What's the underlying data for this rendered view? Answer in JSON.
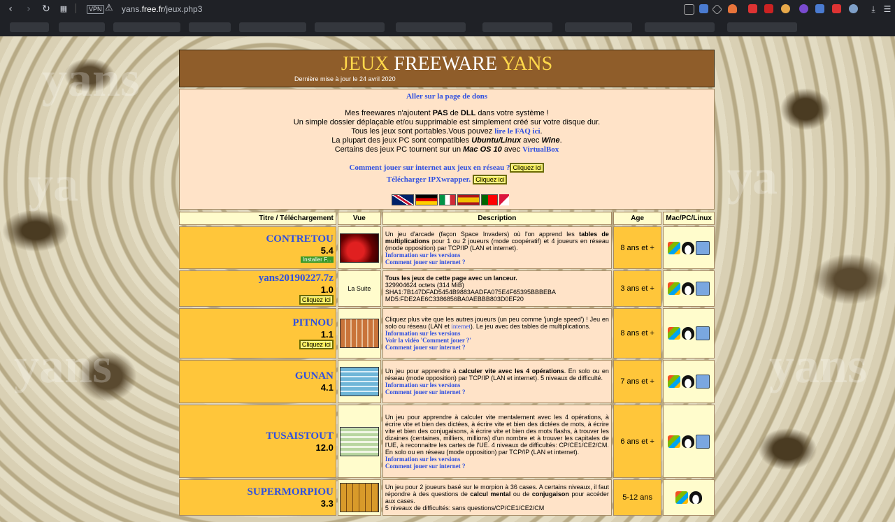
{
  "browser": {
    "url_prefix": "yans.",
    "url_domain": "free.fr",
    "url_path": "/jeux.php3",
    "vpn_label": "VPN"
  },
  "header": {
    "title_a": "JEUX",
    "title_b": "FREEWARE",
    "title_c": "YANS",
    "updated": "Dernière mise à jour le 24 avril 2020"
  },
  "intro": {
    "donate_link": "Aller sur la page de dons",
    "line1_pre": "Mes freewares n'ajoutent ",
    "line1_b1": "PAS",
    "line1_mid": " de ",
    "line1_b2": "DLL",
    "line1_post": " dans votre système !",
    "line2": "Un simple dossier déplaçable et/ou supprimable est simplement créé sur votre disque dur.",
    "line3_pre": "Tous les jeux sont portables.Vous pouvez ",
    "line3_link": "lire le FAQ ici",
    "line3_post": ".",
    "line4_pre": "La plupart des jeux PC sont compatibles ",
    "line4_b1": "Ubuntu/Linux",
    "line4_mid": " avec ",
    "line4_b2": "Wine",
    "line4_post": ".",
    "line5_pre": "Certains des jeux PC tournent sur un ",
    "line5_b": "Mac OS 10",
    "line5_mid": " avec ",
    "line5_link": "VirtualBox",
    "network_link": "Comment jouer sur internet aux jeux en réseau ?",
    "ipx_link": "Télécharger IPXwrapper.",
    "click_label": "Cliquez ici"
  },
  "table": {
    "headers": [
      "Titre / Téléchargement",
      "Vue",
      "Description",
      "Age",
      "Mac/PC/Linux"
    ],
    "rows": [
      {
        "name": "CONTRETOU",
        "version": "5.4",
        "extra": "Installer F...",
        "desc_html_parts": [
          "Un jeu d'arcade (façon Space Invaders) où l'on apprend les ",
          "tables de multiplications",
          " pour 1 ou 2 joueurs (mode coopératif) et 4 joueurs en réseau (mode opposition) par TCP/IP (LAN et internet)."
        ],
        "links": [
          "Information sur les versions",
          "Comment jouer sur internet ?"
        ],
        "age": "8 ans et +"
      },
      {
        "name": "yans20190227.7z",
        "version": "1.0",
        "extra": "Cliquez ici",
        "vue_text": "La Suite",
        "desc_bold": "Tous les jeux de cette page avec un lanceur.",
        "desc_lines": [
          "329904624 octets (314 MiB)",
          "SHA1:7B147DFAD5454B9883AADFA075E4F65395BBBEBA",
          "MD5:FDE2AE6C3386856BA0AEBBB803D0EF20"
        ],
        "age": "3 ans et +"
      },
      {
        "name": "PITNOU",
        "version": "1.1",
        "extra": "Cliquez ici",
        "desc_pre": "Cliquez plus vite que les autres joueurs (un peu comme 'jungle speed') ! Jeu en solo ou réseau (LAN et ",
        "desc_link": "internet",
        "desc_post": "). Le jeu avec des tables de multiplications.",
        "links": [
          "Information sur les versions",
          "Voir la vidéo 'Comment jouer ?'",
          "Comment jouer sur internet ?"
        ],
        "age": "8 ans et +"
      },
      {
        "name": "GUNAN",
        "version": "4.1",
        "desc_pre": "Un jeu pour apprendre à ",
        "desc_bold": "calculer vite avec les 4 opérations",
        "desc_post": ". En solo ou en réseau (mode opposition) par TCP/IP (LAN et internet). 5 niveaux de difficulté.",
        "links": [
          "Information sur les versions",
          "Comment jouer sur internet ?"
        ],
        "age": "7 ans et +"
      },
      {
        "name": "TUSAISTOUT",
        "version": "12.0",
        "desc_text": "Un jeu pour apprendre à calculer vite mentalement avec les 4 opérations, à écrire vite et bien des dictées, à écrire vite et bien des dictées de mots, à écrire vite et bien des conjugaisons, à écrire vite et bien des mots flashs, à trouver les dizaines (centaines, milliers, millions) d'un nombre et à trouver les capitales de l'UE, à reconnaitre les cartes de l'UE. 4 niveaux de difficultés: CP/CE1/CE2/CM. En solo ou en réseau (mode opposition) par TCP/IP (LAN et internet).",
        "links": [
          "Information sur les versions",
          "Comment jouer sur internet ?"
        ],
        "age": "6 ans et +"
      },
      {
        "name": "SUPERMORPIOU",
        "version": "3.3",
        "desc_pre": "Un jeu pour 2 joueurs basé sur le morpion à 36 cases. A certains niveaux, il faut répondre à des questions de ",
        "desc_b1": "calcul mental",
        "desc_mid": " ou de ",
        "desc_b2": "conjugaison",
        "desc_post": " pour accéder aux cases.",
        "desc_line2": "5 niveaux de difficultés: sans questions/CP/CE1/CE2/CM",
        "age": "5-12 ans"
      }
    ]
  }
}
